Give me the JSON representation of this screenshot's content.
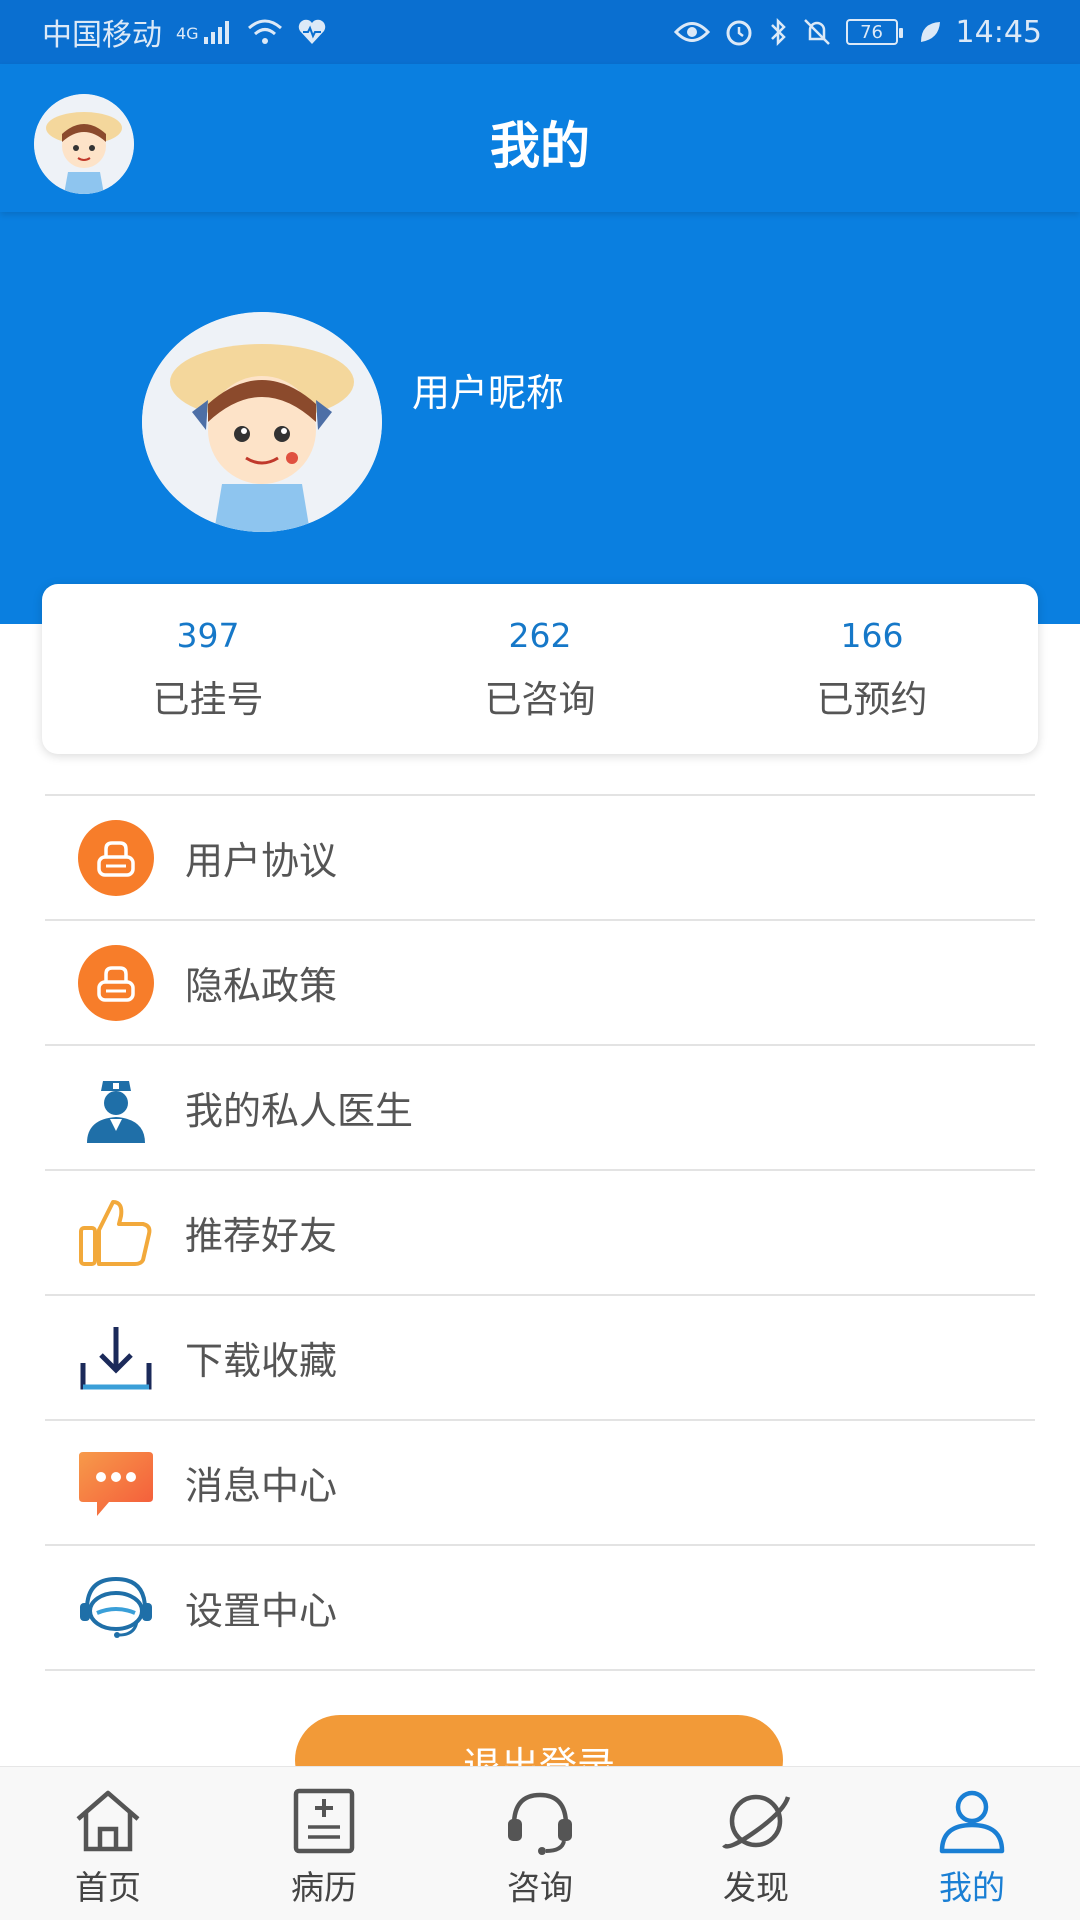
{
  "status_bar": {
    "carrier": "中国移动",
    "network": "4G",
    "battery": "76",
    "time": "14:45",
    "icons": [
      "signal-icon",
      "wifi-icon",
      "health-heart-icon",
      "eye-icon",
      "alarm-icon",
      "bluetooth-icon",
      "mute-icon",
      "leaf-icon"
    ]
  },
  "header": {
    "title": "我的"
  },
  "profile": {
    "nickname": "用户昵称"
  },
  "stats": [
    {
      "value": "397",
      "label": "已挂号"
    },
    {
      "value": "262",
      "label": "已咨询"
    },
    {
      "value": "166",
      "label": "已预约"
    }
  ],
  "menu": {
    "items": [
      {
        "label": "用户协议",
        "icon": "agreement-icon"
      },
      {
        "label": "隐私政策",
        "icon": "privacy-icon"
      },
      {
        "label": "我的私人医生",
        "icon": "doctor-icon"
      },
      {
        "label": "推荐好友",
        "icon": "thumbs-up-icon"
      },
      {
        "label": "下载收藏",
        "icon": "download-icon"
      },
      {
        "label": "消息中心",
        "icon": "message-icon"
      },
      {
        "label": "设置中心",
        "icon": "headset-icon"
      }
    ]
  },
  "logout": {
    "label": "退出登录"
  },
  "bottom_nav": {
    "items": [
      {
        "label": "首页",
        "icon": "home-icon"
      },
      {
        "label": "病历",
        "icon": "medical-record-icon"
      },
      {
        "label": "咨询",
        "icon": "consult-headset-icon"
      },
      {
        "label": "发现",
        "icon": "planet-icon"
      },
      {
        "label": "我的",
        "icon": "user-icon"
      }
    ],
    "active_index": 4
  },
  "colors": {
    "primary": "#0a7fe0",
    "status_bar": "#0a6fd0",
    "accent_orange": "#f29a38",
    "stat_number": "#1678c8",
    "nav_active": "#1a7fd4"
  }
}
